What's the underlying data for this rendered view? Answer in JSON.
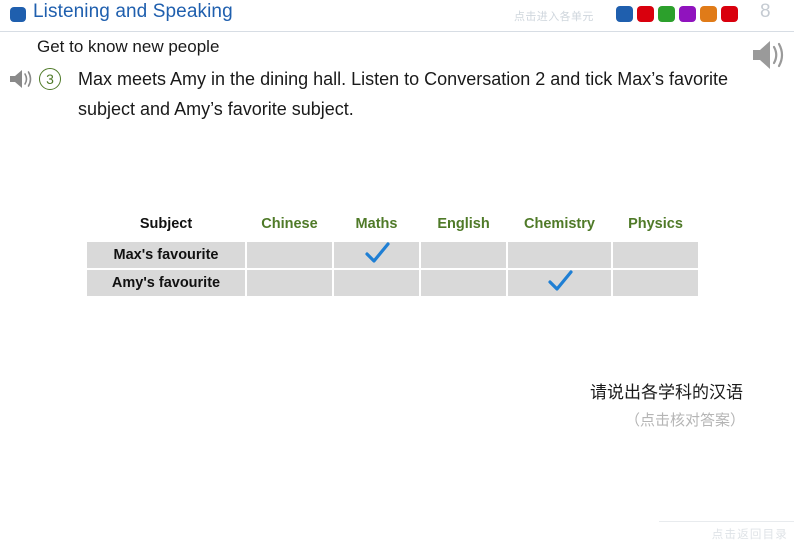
{
  "header": {
    "bullet_icon": "blue-square-icon",
    "title": "Listening and Speaking",
    "hint": "点击进入各单元",
    "page_number": "8",
    "swatches": [
      {
        "name": "unit-swatch-blue",
        "color": "#1f5fae"
      },
      {
        "name": "unit-swatch-red",
        "color": "#d9000d"
      },
      {
        "name": "unit-swatch-green",
        "color": "#2ca02c"
      },
      {
        "name": "unit-swatch-purple",
        "color": "#9013be"
      },
      {
        "name": "unit-swatch-orange",
        "color": "#e07b18"
      },
      {
        "name": "unit-swatch-red-2",
        "color": "#d9000d"
      }
    ]
  },
  "body": {
    "subheading": "Get to know new people",
    "question_number": "3",
    "question_text": "Max meets Amy in the dining hall. Listen to Conversation 2 and tick Max’s favorite subject and Amy’s favorite subject.",
    "speaker_icon_small": "speaker-icon",
    "speaker_icon_large": "speaker-icon"
  },
  "table": {
    "columns": [
      "Subject",
      "Chinese",
      "Maths",
      "English",
      "Chemistry",
      "Physics"
    ],
    "rows": [
      {
        "label": "Max's favourite",
        "ticks": [
          false,
          true,
          false,
          false,
          false
        ]
      },
      {
        "label": "Amy's favourite",
        "ticks": [
          false,
          false,
          false,
          true,
          false
        ]
      }
    ],
    "tick_icon": "check-icon",
    "tick_color": "#1f7fd4",
    "cell_color": "#d9d9d9",
    "header_color": "#4f7a28"
  },
  "notes": {
    "prompt": "请说出各学科的汉语",
    "sub_prompt": "（点击核对答案）",
    "back_to_contents": "点击返回目录"
  }
}
